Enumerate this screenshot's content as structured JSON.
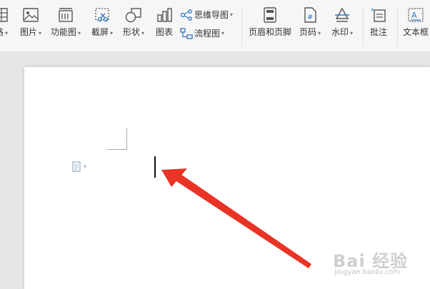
{
  "ribbon": {
    "partial_table_label": "格",
    "picture_label": "图片",
    "function_chart_label": "功能图",
    "screenshot_label": "截屏",
    "shape_label": "形状",
    "chart_label": "图表",
    "mindmap_label": "思维导图",
    "flowchart_label": "流程图",
    "header_footer_label": "页眉和页脚",
    "page_number_label": "页码",
    "watermark_label": "水印",
    "comment_label": "批注",
    "textbox_label": "文本框",
    "dropdown_glyph": "▾"
  },
  "document": {
    "paste_options_glyph": "▾"
  },
  "watermark": {
    "main_text": "Bai 经验",
    "sub_text": "jingyan.baidu.com"
  },
  "colors": {
    "accent_blue": "#2e75c5",
    "arrow_red": "#e83325",
    "icon_gray": "#555555"
  }
}
